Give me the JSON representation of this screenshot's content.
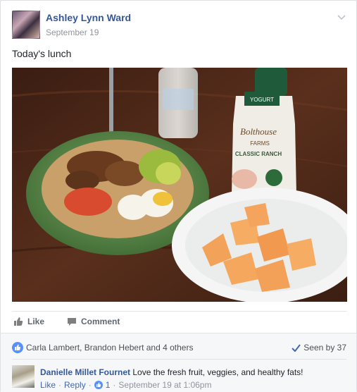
{
  "post": {
    "author": "Ashley Lynn Ward",
    "date": "September 19",
    "text": "Today's lunch"
  },
  "photo": {
    "bottle_brand": "Bolthouse",
    "bottle_label_line1": "FARMS",
    "bottle_label_line2": "CLASSIC RANCH",
    "bottle_label_top": "YOGURT"
  },
  "actions": {
    "like_label": "Like",
    "comment_label": "Comment"
  },
  "reactions": {
    "likers_text": "Carla Lambert, Brandon Hebert and 4 others",
    "seen_text": "Seen by 37"
  },
  "comment": {
    "author": "Danielle Millet Fournet",
    "text": "Love the fresh fruit, veggies, and healthy fats!",
    "like_link": "Like",
    "separator": "·",
    "reply_link": "Reply",
    "like_count": "1",
    "timestamp": "September 19 at 1:06pm"
  },
  "colors": {
    "link_blue": "#365899",
    "meta_gray": "#90949c",
    "like_blue": "#5890ff"
  }
}
